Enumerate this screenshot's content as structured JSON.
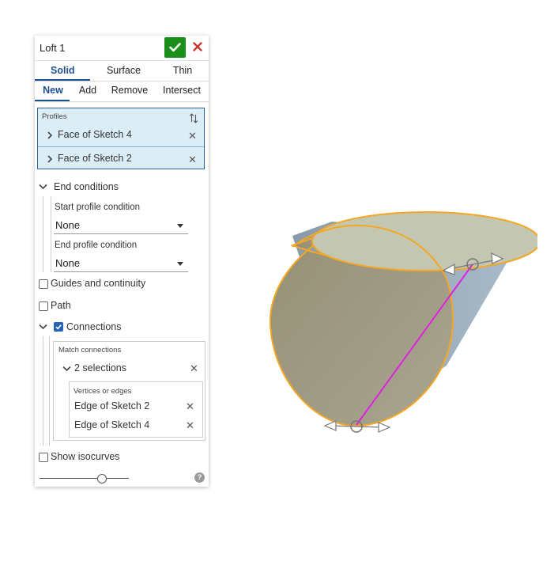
{
  "dialog": {
    "title": "Loft 1",
    "body_type_tabs": [
      "Solid",
      "Surface",
      "Thin"
    ],
    "operation_tabs": [
      "New",
      "Add",
      "Remove",
      "Intersect"
    ],
    "active_body_type": "Solid",
    "active_operation": "New"
  },
  "profiles": {
    "label": "Profiles",
    "items": [
      "Face of Sketch 4",
      "Face of Sketch 2"
    ]
  },
  "end_conditions": {
    "label": "End conditions",
    "start_label": "Start profile condition",
    "start_value": "None",
    "end_label": "End profile condition",
    "end_value": "None"
  },
  "options": {
    "guides_label": "Guides and continuity",
    "guides_checked": false,
    "path_label": "Path",
    "path_checked": false,
    "connections_label": "Connections",
    "connections_checked": true,
    "isocurves_label": "Show isocurves",
    "isocurves_checked": false
  },
  "connections": {
    "match_label": "Match connections",
    "selection_label": "2 selections",
    "vertices_label": "Vertices or edges",
    "edges": [
      "Edge of Sketch 2",
      "Edge of Sketch 4"
    ]
  },
  "isocurve_slider_fraction": 0.68,
  "colors": {
    "accent": "#1d4f91",
    "confirm": "#1a8f1a",
    "cancel": "#c0392b",
    "selection_fill": "#dbeef8",
    "highlight_edge": "#f5a623",
    "connection_line": "#e020e0"
  }
}
